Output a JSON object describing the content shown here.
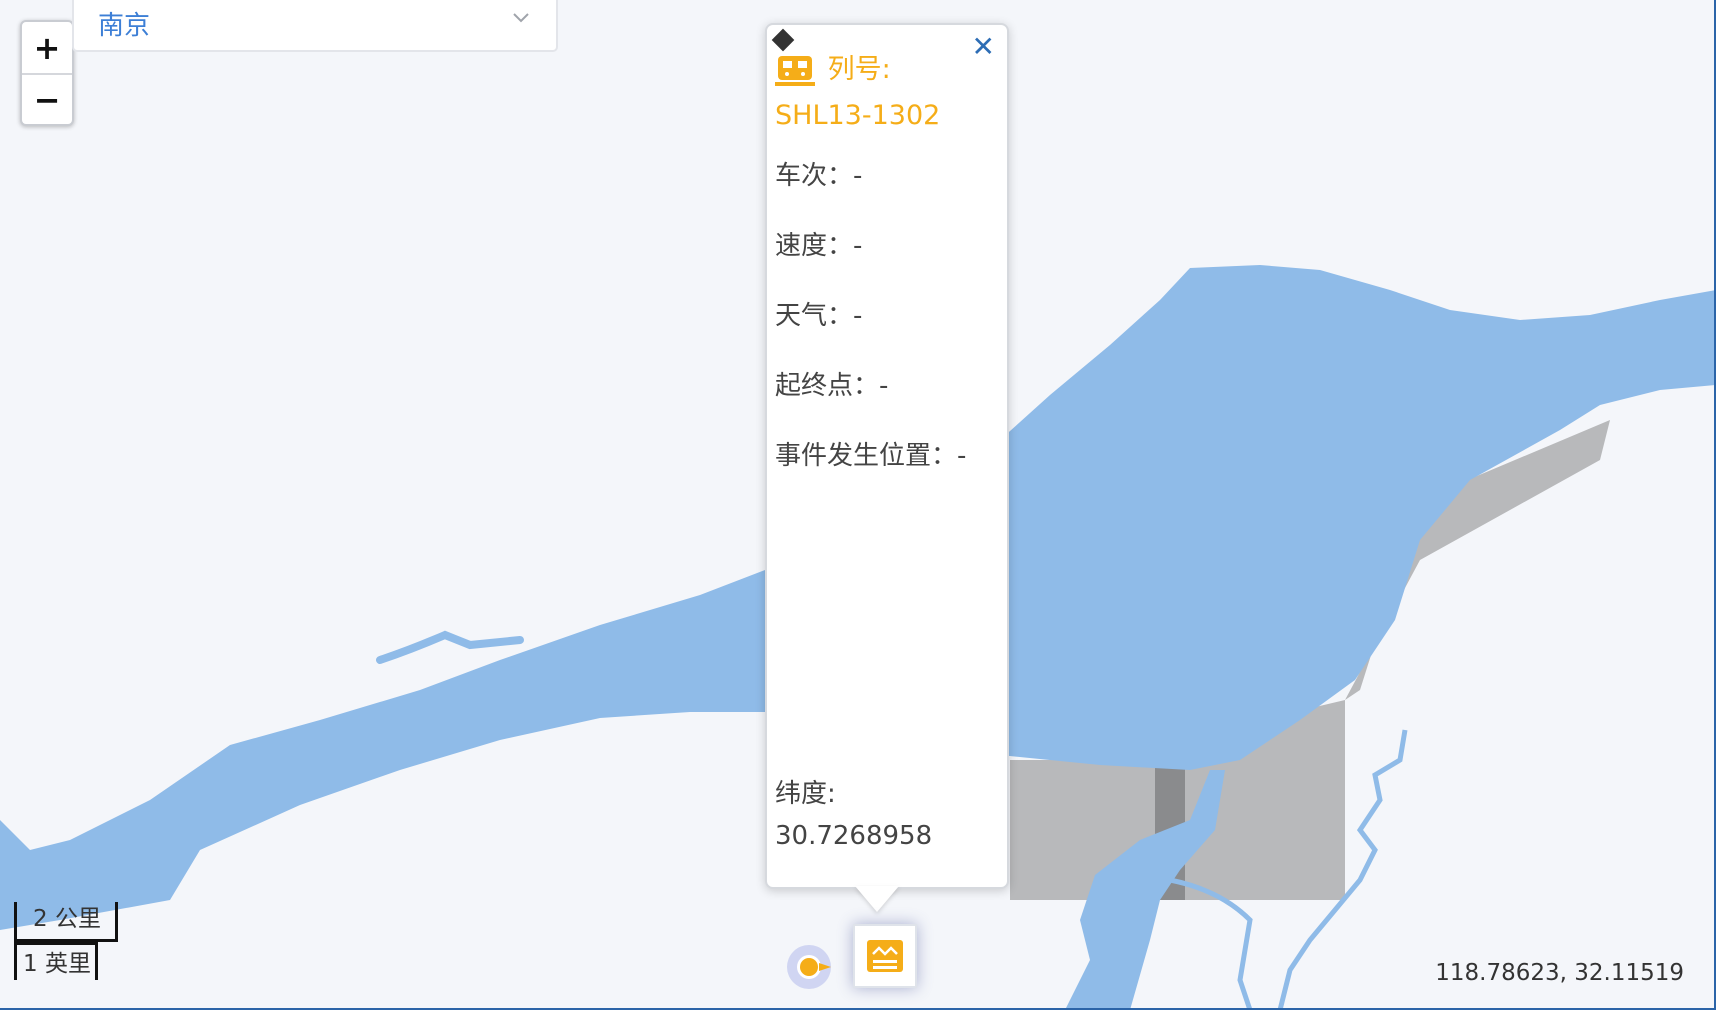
{
  "map": {
    "city_select": {
      "value": "南京"
    },
    "zoom": {
      "in_label": "+",
      "out_label": "−"
    },
    "scale": {
      "km_label": "2 公里",
      "mi_label": "1 英里"
    },
    "cursor_coords": "118.78623, 32.11519",
    "colors": {
      "water": "#8fbbe8",
      "land": "#f4f6fa",
      "building": "#b8b9bb",
      "building_dark": "#8a8b8d",
      "accent": "#f5ad18",
      "frame": "#2b64a8"
    }
  },
  "popup": {
    "close_label": "✕",
    "title_label": "列号:",
    "title_value": "SHL13-1302",
    "fields": [
      {
        "text": "车次：-"
      },
      {
        "text": "速度：-"
      },
      {
        "text": "天气：-"
      },
      {
        "text": "起终点：-"
      },
      {
        "text": "事件发生位置：-"
      }
    ],
    "latitude_label": "纬度:",
    "latitude_value": "30.7268958"
  },
  "icons": [
    "train-icon",
    "close-icon",
    "chevron-down-icon",
    "location-dot-icon",
    "signal-station-icon"
  ]
}
